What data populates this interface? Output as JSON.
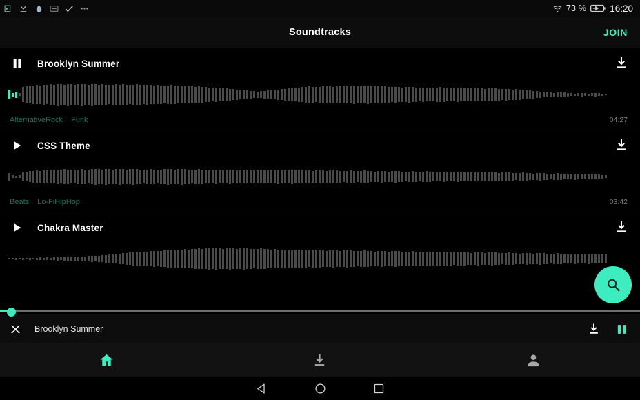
{
  "statusbar": {
    "left_icons": [
      "cast-icon",
      "checkmark-download-icon",
      "water-drop-icon",
      "screenshot-icon",
      "check-icon",
      "more-dots-icon"
    ],
    "battery_percent": "73 %",
    "wifi_icon": "wifi-icon",
    "battery_icon": "battery-charging-icon",
    "clock": "16:20"
  },
  "appbar": {
    "title": "Soundtracks",
    "action_label": "JOIN"
  },
  "colors": {
    "accent": "#3dedc0",
    "background": "#000000",
    "surface": "#0d0d0d",
    "waveform": "#4b4b4b",
    "tag": "#1e6d5c",
    "duration": "#7a7a7a"
  },
  "tracks": [
    {
      "title": "Brooklyn Summer",
      "state": "playing",
      "play_icon": "pause-icon",
      "download_icon": "download-icon",
      "tags": [
        "AlternativeRock",
        "Funk"
      ],
      "duration": "04:27",
      "progress_percent": 2,
      "waveform": [
        14,
        5,
        9,
        4,
        22,
        24,
        26,
        27,
        28,
        27,
        29,
        28,
        30,
        29,
        31,
        30,
        29,
        31,
        30,
        29,
        30,
        31,
        30,
        29,
        31,
        30,
        29,
        30,
        29,
        28,
        29,
        30,
        29,
        30,
        29,
        28,
        29,
        30,
        29,
        28,
        29,
        28,
        27,
        28,
        27,
        26,
        27,
        28,
        27,
        26,
        25,
        26,
        25,
        24,
        23,
        24,
        23,
        22,
        21,
        20,
        21,
        20,
        19,
        18,
        17,
        16,
        15,
        14,
        13,
        12,
        11,
        10,
        9,
        10,
        11,
        12,
        13,
        14,
        15,
        16,
        17,
        18,
        19,
        20,
        21,
        22,
        23,
        24,
        23,
        22,
        23,
        24,
        25,
        24,
        23,
        24,
        25,
        26,
        25,
        26,
        27,
        26,
        25,
        26,
        27,
        26,
        25,
        24,
        25,
        24,
        23,
        22,
        23,
        22,
        21,
        22,
        23,
        22,
        21,
        20,
        21,
        20,
        19,
        20,
        21,
        22,
        21,
        20,
        19,
        20,
        21,
        20,
        19,
        18,
        19,
        20,
        19,
        18,
        17,
        18,
        19,
        18,
        17,
        16,
        17,
        16,
        15,
        16,
        15,
        14,
        13,
        12,
        11,
        10,
        9,
        8,
        7,
        6,
        5,
        6,
        7,
        6,
        5,
        4,
        3,
        4,
        5,
        4,
        3,
        4,
        5,
        4,
        3,
        2
      ]
    },
    {
      "title": "CSS Theme",
      "state": "paused",
      "play_icon": "play-icon",
      "download_icon": "download-icon",
      "tags": [
        "Beats",
        "Lo-FiHipHop"
      ],
      "duration": "03:42",
      "progress_percent": 0,
      "waveform": [
        11,
        4,
        3,
        4,
        12,
        14,
        16,
        17,
        18,
        17,
        19,
        18,
        20,
        19,
        21,
        20,
        22,
        21,
        20,
        19,
        21,
        22,
        21,
        20,
        22,
        23,
        22,
        21,
        23,
        22,
        21,
        22,
        23,
        22,
        21,
        22,
        23,
        22,
        21,
        20,
        21,
        22,
        21,
        20,
        21,
        22,
        23,
        22,
        21,
        22,
        23,
        22,
        21,
        20,
        21,
        22,
        21,
        20,
        19,
        20,
        21,
        20,
        19,
        20,
        21,
        20,
        19,
        18,
        19,
        20,
        19,
        18,
        19,
        20,
        19,
        18,
        19,
        20,
        21,
        20,
        19,
        20,
        21,
        20,
        19,
        18,
        19,
        18,
        17,
        18,
        19,
        18,
        17,
        18,
        19,
        18,
        17,
        16,
        17,
        18,
        17,
        16,
        17,
        18,
        17,
        16,
        15,
        16,
        17,
        16,
        15,
        16,
        17,
        16,
        15,
        14,
        15,
        16,
        15,
        14,
        15,
        16,
        15,
        14,
        13,
        14,
        15,
        14,
        13,
        14,
        15,
        14,
        13,
        12,
        13,
        14,
        13,
        12,
        13,
        14,
        13,
        12,
        11,
        12,
        13,
        12,
        11,
        10,
        11,
        12,
        11,
        10,
        9,
        10,
        11,
        10,
        9,
        8,
        9,
        10,
        9,
        8,
        7,
        8,
        9,
        8,
        7,
        6,
        7,
        8,
        7,
        6,
        5,
        4
      ]
    },
    {
      "title": "Chakra Master",
      "state": "paused",
      "play_icon": "play-icon",
      "download_icon": "download-icon",
      "tags": [],
      "duration": "",
      "progress_percent": 0,
      "waveform": [
        2,
        2,
        3,
        2,
        3,
        2,
        3,
        2,
        3,
        4,
        3,
        4,
        3,
        4,
        5,
        4,
        5,
        6,
        5,
        6,
        7,
        6,
        7,
        8,
        9,
        8,
        9,
        10,
        11,
        12,
        13,
        14,
        15,
        16,
        17,
        18,
        19,
        20,
        21,
        20,
        21,
        22,
        23,
        22,
        23,
        24,
        25,
        26,
        25,
        26,
        27,
        28,
        27,
        28,
        29,
        30,
        29,
        30,
        31,
        30,
        31,
        30,
        29,
        30,
        31,
        30,
        29,
        30,
        31,
        30,
        29,
        28,
        29,
        30,
        29,
        28,
        27,
        28,
        27,
        26,
        27,
        26,
        25,
        26,
        27,
        26,
        25,
        24,
        25,
        26,
        25,
        24,
        23,
        24,
        25,
        24,
        23,
        24,
        25,
        24,
        23,
        22,
        23,
        24,
        23,
        22,
        21,
        22,
        23,
        22,
        21,
        22,
        23,
        22,
        21,
        20,
        21,
        22,
        21,
        20,
        19,
        20,
        21,
        20,
        19,
        20,
        21,
        20,
        19,
        18,
        19,
        20,
        19,
        18,
        17,
        18,
        19,
        18,
        17,
        18,
        19,
        18,
        17,
        16,
        17,
        18,
        17,
        16,
        15,
        16,
        17,
        16,
        15,
        16,
        17,
        16,
        15,
        14,
        15,
        16,
        15,
        14,
        13,
        14,
        15,
        14,
        13,
        14,
        15,
        14,
        13,
        12,
        13,
        14
      ]
    }
  ],
  "fab": {
    "icon": "search-icon",
    "label": "Search"
  },
  "miniplayer": {
    "close_icon": "close-icon",
    "title": "Brooklyn Summer",
    "download_icon": "download-icon",
    "playpause_icon": "pause-icon",
    "progress_percent": 1.7
  },
  "bottomnav": {
    "items": [
      {
        "icon": "home-icon",
        "label": "Home",
        "active": true
      },
      {
        "icon": "download-icon",
        "label": "Downloads",
        "active": false
      },
      {
        "icon": "person-icon",
        "label": "Profile",
        "active": false
      }
    ]
  },
  "sysnav": {
    "back_icon": "back-triangle-icon",
    "home_icon": "home-circle-icon",
    "recents_icon": "recents-square-icon"
  }
}
